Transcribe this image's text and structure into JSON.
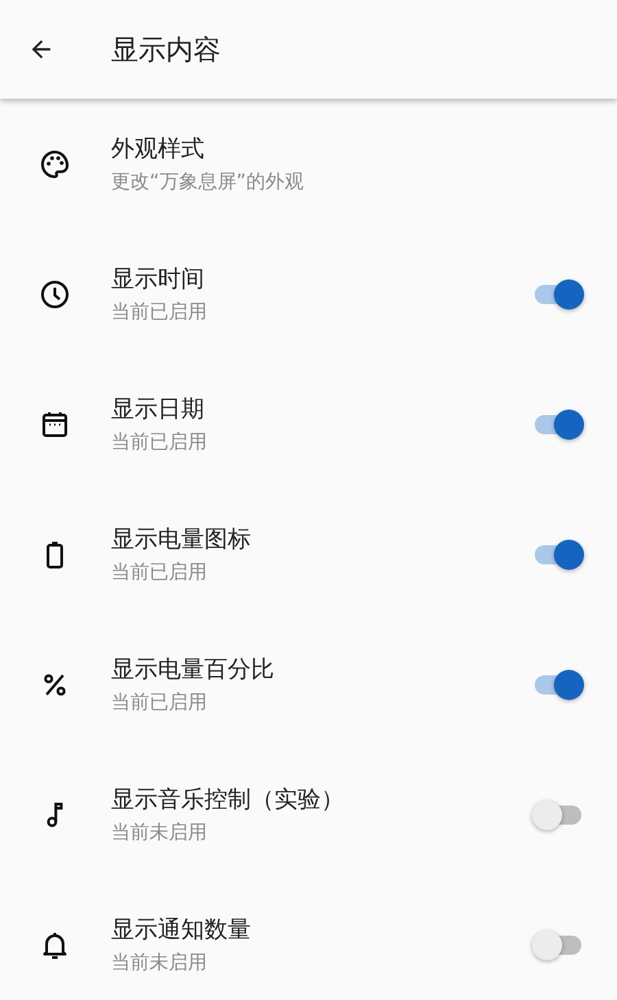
{
  "app_bar": {
    "title": "显示内容"
  },
  "items": [
    {
      "kind": "link",
      "title": "外观样式",
      "subtitle": "更改“万象息屏”的外观"
    },
    {
      "kind": "toggle",
      "title": "显示时间",
      "subtitle": "当前已启用",
      "on": true
    },
    {
      "kind": "toggle",
      "title": "显示日期",
      "subtitle": "当前已启用",
      "on": true
    },
    {
      "kind": "toggle",
      "title": "显示电量图标",
      "subtitle": "当前已启用",
      "on": true
    },
    {
      "kind": "toggle",
      "title": "显示电量百分比",
      "subtitle": "当前已启用",
      "on": true
    },
    {
      "kind": "toggle",
      "title": "显示音乐控制（实验）",
      "subtitle": "当前未启用",
      "on": false
    },
    {
      "kind": "toggle",
      "title": "显示通知数量",
      "subtitle": "当前未启用",
      "on": false
    }
  ]
}
